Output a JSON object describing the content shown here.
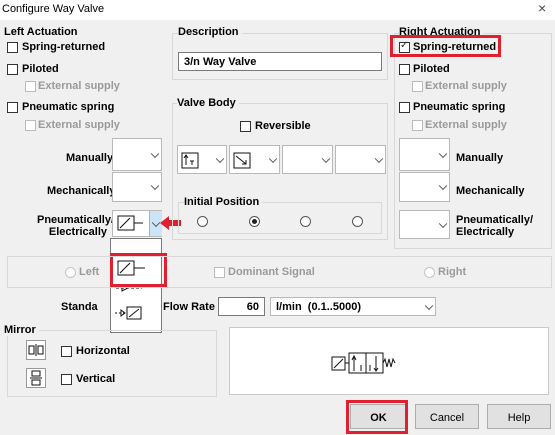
{
  "window": {
    "title": "Configure Way Valve",
    "close": "×"
  },
  "left_actuation": {
    "heading": "Left Actuation",
    "spring_returned": "Spring-returned",
    "piloted": "Piloted",
    "external_supply_1": "External supply",
    "pneumatic_spring": "Pneumatic spring",
    "external_supply_2": "External supply",
    "manually": "Manually",
    "mechanically": "Mechanically",
    "pneumatically": "Pneumatically/\nElectrically"
  },
  "description": {
    "heading": "Description",
    "value": "3/n Way Valve"
  },
  "valve_body": {
    "heading": "Valve Body",
    "reversible": "Reversible"
  },
  "initial_position": {
    "heading": "Initial Position",
    "selected_index": 1
  },
  "right_actuation": {
    "heading": "Right Actuation",
    "spring_returned": "Spring-returned",
    "spring_returned_checked": true,
    "piloted": "Piloted",
    "external_supply_1": "External supply",
    "pneumatic_spring": "Pneumatic spring",
    "external_supply_2": "External supply",
    "manually": "Manually",
    "mechanically": "Mechanically",
    "pneumatically": "Pneumatically/\nElectrically"
  },
  "dominant": {
    "left": "Left",
    "dominant_signal": "Dominant Signal",
    "right": "Right"
  },
  "flow": {
    "standard_prefix": "Standa",
    "label": "Flow Rate",
    "value": "60",
    "unit": "l/min  (0.1..5000)"
  },
  "mirror": {
    "heading": "Mirror",
    "horizontal": "Horizontal",
    "vertical": "Vertical"
  },
  "buttons": {
    "ok": "OK",
    "cancel": "Cancel",
    "help": "Help"
  },
  "colors": {
    "highlight": "#e0202e",
    "arrow": "#e0202e"
  },
  "icons": [
    "close-icon",
    "chevron-down-icon",
    "solenoid-icon",
    "pilot-line-icon",
    "valve-symbol-icon",
    "mirror-horizontal-icon",
    "mirror-vertical-icon",
    "red-arrow-icon"
  ]
}
